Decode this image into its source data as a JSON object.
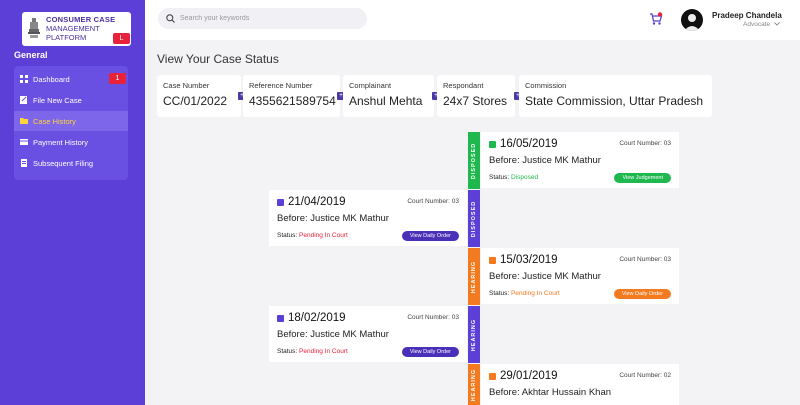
{
  "logo": {
    "line1": "CONSUMER CASE",
    "line2": "MANAGEMENT",
    "line3": "PLATFORM",
    "badge": "L"
  },
  "sidebar": {
    "heading": "General",
    "items": [
      {
        "label": "Dashboard",
        "icon": "grid-icon",
        "badge": "1"
      },
      {
        "label": "File New Case",
        "icon": "edit-icon"
      },
      {
        "label": "Case History",
        "icon": "folder-icon",
        "active": true
      },
      {
        "label": "Payment History",
        "icon": "card-icon"
      },
      {
        "label": "Subsequent Filing",
        "icon": "file-icon"
      }
    ]
  },
  "search": {
    "placeholder": "Search your keywords"
  },
  "user": {
    "name": "Pradeep Chandela",
    "role": "Advocate"
  },
  "page_title": "View Your Case Status",
  "fields": [
    {
      "label": "Case Number",
      "value": "CC/01/2022"
    },
    {
      "label": "Reference Number",
      "value": "4355621589754"
    },
    {
      "label": "Complainant",
      "value": "Anshul Mehta"
    },
    {
      "label": "Respondant",
      "value": "24x7 Stores"
    },
    {
      "label": "Commission",
      "value": "State Commission, Uttar Pradesh"
    }
  ],
  "timeline": {
    "stages": [
      {
        "label": "DISPOSED",
        "color": "#1fb84f"
      },
      {
        "label": "DISPOSED",
        "color": "#5b3fd6"
      },
      {
        "label": "HEARING",
        "color": "#f47a1f"
      },
      {
        "label": "HEARING",
        "color": "#5b3fd6"
      },
      {
        "label": "HEARING",
        "color": "#f47a1f"
      }
    ],
    "cards": [
      {
        "date": "16/05/2019",
        "court": "Court Number: 03",
        "before_prefix": "Before:",
        "judge": "Justice MK Mathur",
        "status_prefix": "Status:",
        "status": "Disposed",
        "status_color": "#1fb84f",
        "button": "View Judgement",
        "color": "#1fb84f"
      },
      {
        "date": "21/04/2019",
        "court": "Court Number: 03",
        "before_prefix": "Before:",
        "judge": "Justice MK Mathur",
        "status_prefix": "Status:",
        "status": "Pending In Court",
        "status_color": "#e8223a",
        "button": "View Daily Order",
        "color": "#5b3fd6"
      },
      {
        "date": "15/03/2019",
        "court": "Court Number: 03",
        "before_prefix": "Before:",
        "judge": "Justice MK Mathur",
        "status_prefix": "Status:",
        "status": "Pending In Court",
        "status_color": "#f47a1f",
        "button": "View Daily Order",
        "color": "#f47a1f"
      },
      {
        "date": "18/02/2019",
        "court": "Court Number: 03",
        "before_prefix": "Before:",
        "judge": "Justice MK Mathur",
        "status_prefix": "Status:",
        "status": "Pending In Court",
        "status_color": "#e8223a",
        "button": "View Daily Order",
        "color": "#5b3fd6"
      },
      {
        "date": "29/01/2019",
        "court": "Court Number: 02",
        "before_prefix": "Before:",
        "judge": "Akhtar Hussain Khan",
        "color": "#f47a1f"
      }
    ]
  },
  "colors": {
    "sidebar": "#5b3fd6",
    "accent_green": "#1fb84f",
    "accent_orange": "#f47a1f",
    "badge_red": "#e8223a"
  }
}
